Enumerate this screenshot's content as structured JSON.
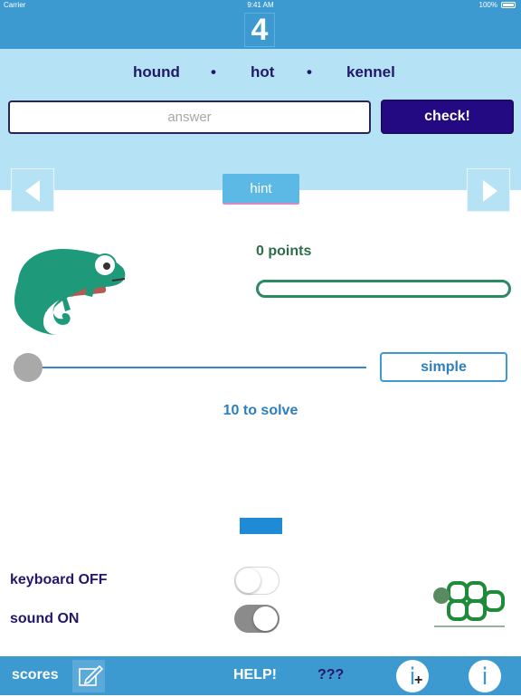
{
  "status_bar": {
    "carrier": "Carrier",
    "time": "9:41 AM",
    "battery": "100%"
  },
  "header": {
    "logo_glyph": "4"
  },
  "clues": [
    "hound",
    "hot",
    "kennel"
  ],
  "answer": {
    "placeholder": "answer",
    "value": ""
  },
  "check_label": "check!",
  "hint_label": "hint",
  "points_text": "0 points",
  "progress": 0,
  "slider": {
    "value": 0
  },
  "difficulty_label": "simple",
  "to_solve": "10 to solve",
  "settings": {
    "keyboard_label": "keyboard OFF",
    "keyboard_on": false,
    "sound_label": "sound ON",
    "sound_on": true
  },
  "bottom_bar": {
    "scores_label": "scores",
    "help_label": "HELP!",
    "mystery_label": "???"
  },
  "icons": {
    "mascot": "chameleon-icon",
    "brand": "celtic-knot-logo",
    "edit": "edit-icon",
    "info_plus": "info-plus-icon",
    "info": "info-icon"
  },
  "colors": {
    "accent": "#3d9ad1",
    "band": "#b5e2f4",
    "check": "#240a82",
    "text_dark": "#22186b",
    "green": "#2b8a64"
  }
}
